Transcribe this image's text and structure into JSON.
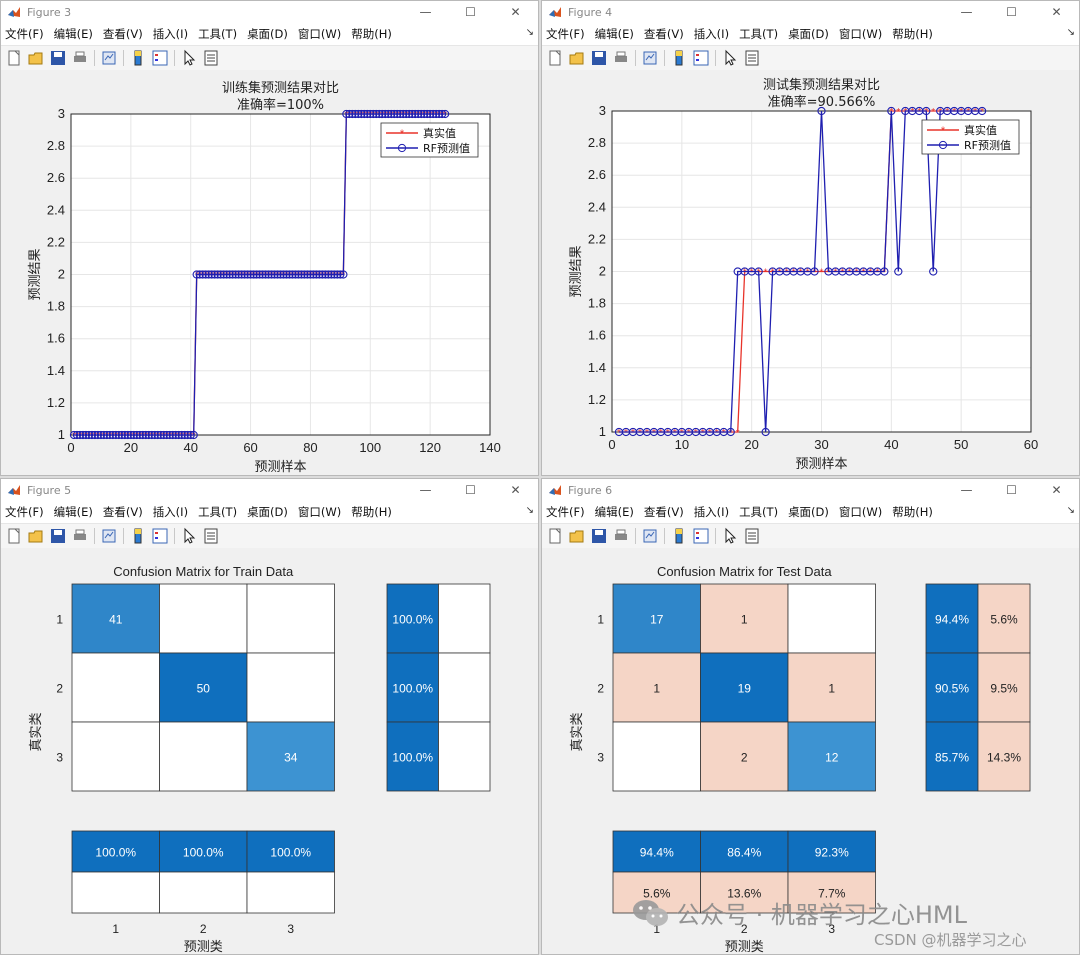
{
  "menus": [
    "文件(F)",
    "编辑(E)",
    "查看(V)",
    "插入(I)",
    "工具(T)",
    "桌面(D)",
    "窗口(W)",
    "帮助(H)"
  ],
  "colors": {
    "true_line": "#e8332a",
    "pred_line": "#1f1fb0",
    "marker_fill": "#8a2be2",
    "cm_dark": "#0f6fbe",
    "cm_mid": "#2f86c9",
    "cm_light": "#3d93d2",
    "cm_peach": "#f5d5c6"
  },
  "fig3": {
    "window_title": "Figure 3",
    "title": "训练集预测结果对比",
    "subtitle": "准确率=100%",
    "xlabel": "预测样本",
    "ylabel": "预测结果",
    "legend": [
      "真实值",
      "RF预测值"
    ],
    "chart_data": {
      "type": "line",
      "xlim": [
        0,
        140
      ],
      "ylim": [
        1,
        3
      ],
      "xticks": [
        0,
        20,
        40,
        60,
        80,
        100,
        120,
        140
      ],
      "yticks": [
        1,
        1.2,
        1.4,
        1.6,
        1.8,
        2,
        2.2,
        2.4,
        2.6,
        2.8,
        3
      ],
      "grid": true,
      "legend_position": "top-right",
      "segments": [
        {
          "class": 1,
          "from": 1,
          "to": 41
        },
        {
          "class": 2,
          "from": 42,
          "to": 91
        },
        {
          "class": 3,
          "from": 92,
          "to": 125
        }
      ],
      "series": [
        {
          "name": "真实值",
          "values_same_as_segments": true
        },
        {
          "name": "RF预测值",
          "values_same_as_segments": true
        }
      ]
    }
  },
  "fig4": {
    "window_title": "Figure 4",
    "title": "测试集预测结果对比",
    "subtitle": "准确率=90.566%",
    "xlabel": "预测样本",
    "ylabel": "预测结果",
    "legend": [
      "真实值",
      "RF预测值"
    ],
    "chart_data": {
      "type": "line",
      "xlim": [
        0,
        60
      ],
      "ylim": [
        1,
        3
      ],
      "xticks": [
        0,
        10,
        20,
        30,
        40,
        50,
        60
      ],
      "yticks": [
        1,
        1.2,
        1.4,
        1.6,
        1.8,
        2,
        2.2,
        2.4,
        2.6,
        2.8,
        3
      ],
      "grid": true,
      "legend_position": "top-right",
      "series": [
        {
          "name": "真实值",
          "values": [
            1,
            1,
            1,
            1,
            1,
            1,
            1,
            1,
            1,
            1,
            1,
            1,
            1,
            1,
            1,
            1,
            1,
            1,
            2,
            2,
            2,
            2,
            2,
            2,
            2,
            2,
            2,
            2,
            2,
            2,
            2,
            2,
            2,
            2,
            2,
            2,
            2,
            2,
            2,
            3,
            3,
            3,
            3,
            3,
            3,
            3,
            3,
            3,
            3,
            3,
            3,
            3,
            3
          ]
        },
        {
          "name": "RF预测值",
          "values": [
            1,
            1,
            1,
            1,
            1,
            1,
            1,
            1,
            1,
            1,
            1,
            1,
            1,
            1,
            1,
            1,
            1,
            2,
            2,
            2,
            2,
            1,
            2,
            2,
            2,
            2,
            2,
            2,
            2,
            3,
            2,
            2,
            2,
            2,
            2,
            2,
            2,
            2,
            2,
            3,
            2,
            3,
            3,
            3,
            3,
            2,
            3,
            3,
            3,
            3,
            3,
            3,
            3
          ]
        }
      ]
    }
  },
  "fig5": {
    "window_title": "Figure 5",
    "title": "Confusion Matrix for Train Data",
    "xlabel": "预测类",
    "ylabel": "真实类",
    "class_labels": [
      "1",
      "2",
      "3"
    ],
    "chart_data": {
      "type": "heatmap",
      "matrix": [
        [
          "41",
          "",
          ""
        ],
        [
          "",
          "50",
          ""
        ],
        [
          "",
          "",
          "34"
        ]
      ],
      "row_summary": [
        [
          "100.0%",
          ""
        ],
        [
          "100.0%",
          ""
        ],
        [
          "100.0%",
          ""
        ]
      ],
      "col_summary": [
        [
          "100.0%",
          "100.0%",
          "100.0%"
        ],
        [
          "",
          "",
          ""
        ]
      ]
    }
  },
  "fig6": {
    "window_title": "Figure 6",
    "title": "Confusion Matrix for Test Data",
    "xlabel": "预测类",
    "ylabel": "真实类",
    "class_labels": [
      "1",
      "2",
      "3"
    ],
    "chart_data": {
      "type": "heatmap",
      "matrix": [
        [
          "17",
          "1",
          ""
        ],
        [
          "1",
          "19",
          "1"
        ],
        [
          "",
          "2",
          "12"
        ]
      ],
      "row_summary": [
        [
          "94.4%",
          "5.6%"
        ],
        [
          "90.5%",
          "9.5%"
        ],
        [
          "85.7%",
          "14.3%"
        ]
      ],
      "col_summary": [
        [
          "94.4%",
          "86.4%",
          "92.3%"
        ],
        [
          "5.6%",
          "13.6%",
          "7.7%"
        ]
      ]
    }
  },
  "watermark": "公众号 · 机器学习之心HML",
  "csdn_mark": "CSDN @机器学习之心"
}
